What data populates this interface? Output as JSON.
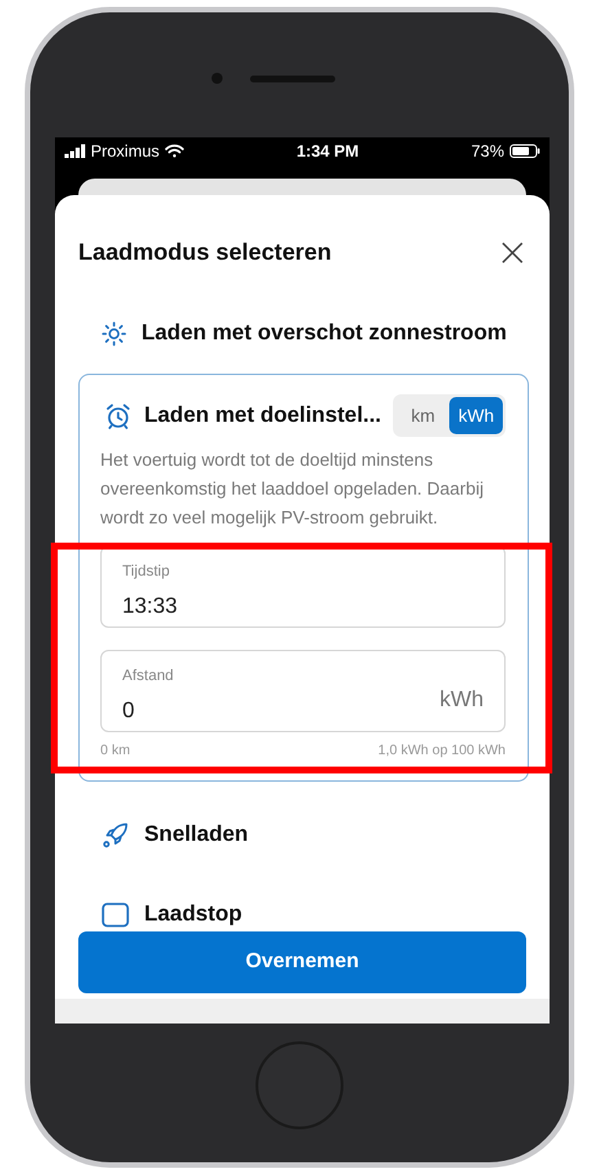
{
  "status_bar": {
    "carrier": "Proximus",
    "time": "1:34 PM",
    "battery": "73%"
  },
  "sheet": {
    "title": "Laadmodus selecteren"
  },
  "modes": [
    {
      "kind": "sun",
      "label": "Laden met overschot zonnestroom",
      "expanded": false
    },
    {
      "kind": "alarm",
      "label": "Laden met doelinstel...",
      "expanded": true,
      "description": "Het voertuig wordt tot de doeltijd minstens overeenkomstig het laaddoel opgeladen. Daarbij wordt zo veel mogelijk PV-stroom gebruikt.",
      "unit_toggle": [
        {
          "label": "km",
          "selected": false
        },
        {
          "label": "kWh",
          "selected": true
        }
      ],
      "fields": [
        {
          "label": "Tijdstip",
          "value": "13:33"
        },
        {
          "label": "Afstand",
          "value": "0",
          "unit": "kWh"
        }
      ],
      "range_min": "0 km",
      "range_max": "1,0 kWh op 100 kWh"
    },
    {
      "kind": "rocket",
      "label": "Snelladen",
      "expanded": false
    },
    {
      "kind": "stop",
      "label": "Laadstop",
      "expanded": false
    }
  ],
  "primary_button": "Overnemen"
}
